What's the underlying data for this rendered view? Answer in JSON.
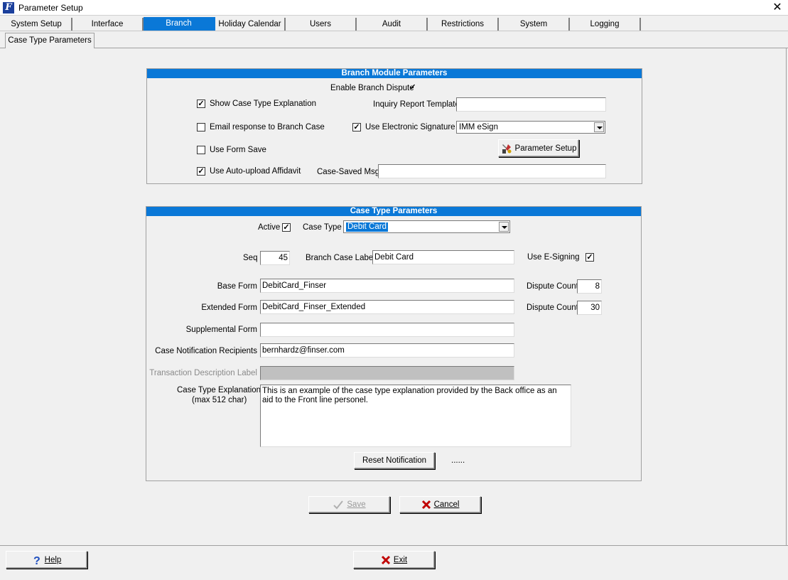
{
  "window": {
    "title": "Parameter Setup",
    "close_glyph": "✕"
  },
  "tabs": [
    "System Setup",
    "Interface",
    "Branch",
    "Holiday Calendar",
    "Users",
    "Audit",
    "Restrictions",
    "System",
    "Logging"
  ],
  "active_tab": "Branch",
  "subtab": "Case Type Parameters",
  "branch_module": {
    "header": "Branch Module Parameters",
    "enable_branch_dispute": {
      "label": "Enable Branch Dispute",
      "checked": "✓"
    },
    "show_case_type_explanation": {
      "label": "Show Case Type Explanation",
      "checked": "✓"
    },
    "email_response": {
      "label": "Email response to Branch Case",
      "checked": ""
    },
    "use_form_save": {
      "label": "Use Form Save",
      "checked": ""
    },
    "use_auto_upload": {
      "label": "Use Auto-upload Affidavit",
      "checked": "✓"
    },
    "inquiry_report_template": {
      "label": "Inquiry Report Template",
      "value": ""
    },
    "use_electronic_signature": {
      "label": "Use Electronic Signature",
      "checked": "✓",
      "selected": "IMM eSign"
    },
    "parameter_setup_button": "Parameter Setup",
    "case_saved_msg": {
      "label": "Case-Saved Msg",
      "value": ""
    }
  },
  "case_type": {
    "header": "Case Type Parameters",
    "active": {
      "label": "Active",
      "checked": "✓"
    },
    "case_type": {
      "label": "Case Type",
      "selected": "Debit Card"
    },
    "seq": {
      "label": "Seq",
      "value": "45"
    },
    "branch_case_label": {
      "label": "Branch Case Label",
      "value": "Debit Card"
    },
    "use_esigning": {
      "label": "Use E-Signing",
      "checked": "✓"
    },
    "base_form": {
      "label": "Base Form",
      "value": "DebitCard_Finser"
    },
    "dispute_count_1": {
      "label": "Dispute Count",
      "value": "8"
    },
    "extended_form": {
      "label": "Extended Form",
      "value": "DebitCard_Finser_Extended"
    },
    "dispute_count_2": {
      "label": "Dispute Count",
      "value": "30"
    },
    "supplemental_form": {
      "label": "Supplemental Form",
      "value": ""
    },
    "notification_recipients": {
      "label": "Case Notification Recipients",
      "value": "bernhardz@finser.com"
    },
    "transaction_description_label": {
      "label": "Transaction Description Label",
      "value": ""
    },
    "case_type_explanation": {
      "label": "Case Type Explanation",
      "sublabel": "(max 512 char)",
      "value": "This is an example of the case type explanation provided by the Back office as an aid to the Front line personel."
    },
    "reset_notification_button": "Reset Notification",
    "ellipsis": "......"
  },
  "actions": {
    "save": "Save",
    "cancel": "Cancel"
  },
  "footer": {
    "help": "Help",
    "exit": "Exit"
  },
  "colors": {
    "accent": "#0a78d7",
    "cancel_x": "#c00000",
    "help_icon": "#1f4fbf"
  }
}
